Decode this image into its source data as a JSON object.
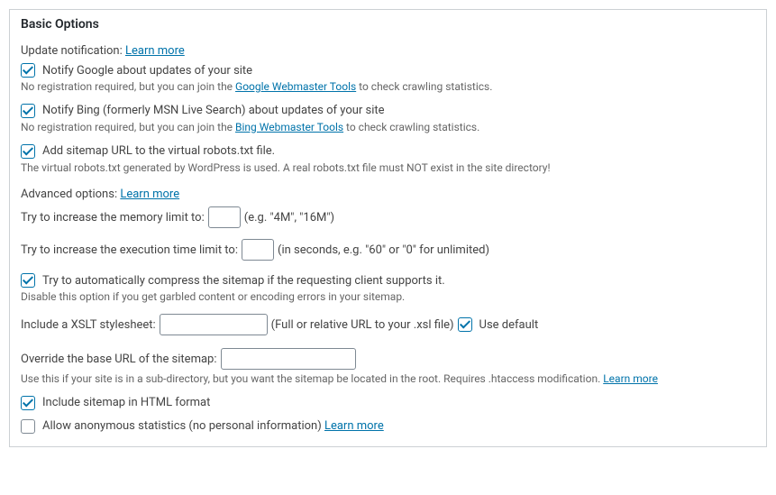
{
  "title": "Basic Options",
  "update": {
    "label": "Update notification:",
    "learn": "Learn more",
    "google_cb_label": "Notify Google about updates of your site",
    "google_desc_pre": "No registration required, but you can join the ",
    "google_desc_link": "Google Webmaster Tools",
    "google_desc_post": " to check crawling statistics.",
    "bing_cb_label": "Notify Bing (formerly MSN Live Search) about updates of your site",
    "bing_desc_pre": "No registration required, but you can join the ",
    "bing_desc_link": "Bing Webmaster Tools",
    "bing_desc_post": " to check crawling statistics.",
    "robots_cb_label": "Add sitemap URL to the virtual robots.txt file.",
    "robots_desc": "The virtual robots.txt generated by WordPress is used. A real robots.txt file must NOT exist in the site directory!"
  },
  "advanced": {
    "label": "Advanced options:",
    "learn": "Learn more",
    "mem_label": "Try to increase the memory limit to:",
    "mem_hint": "(e.g. \"4M\", \"16M\")",
    "exec_label": "Try to increase the execution time limit to:",
    "exec_hint": "(in seconds, e.g. \"60\" or \"0\" for unlimited)",
    "compress_cb_label": "Try to automatically compress the sitemap if the requesting client supports it.",
    "compress_desc": "Disable this option if you get garbled content or encoding errors in your sitemap.",
    "xslt_label": "Include a XSLT stylesheet:",
    "xslt_hint": "(Full or relative URL to your .xsl file)",
    "xslt_default_cb": "Use default",
    "override_label": "Override the base URL of the sitemap:",
    "override_desc": "Use this if your site is in a sub-directory, but you want the sitemap be located in the root. Requires .htaccess modification. ",
    "override_learn": "Learn more",
    "html_cb_label": "Include sitemap in HTML format",
    "anon_cb_label": "Allow anonymous statistics (no personal information) ",
    "anon_learn": "Learn more"
  }
}
